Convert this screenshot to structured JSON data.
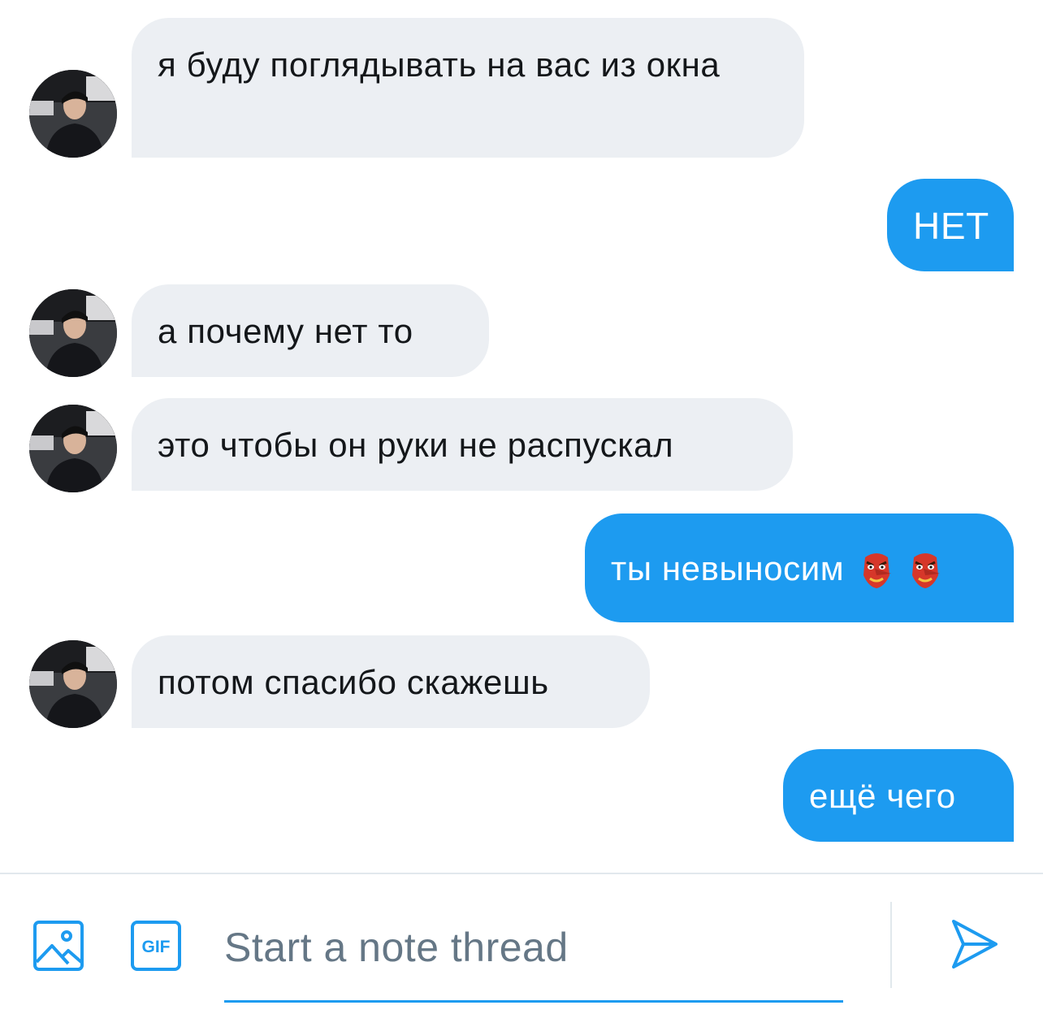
{
  "conversation": {
    "messages": [
      {
        "side": "in",
        "text": "я буду поглядывать на вас из окна"
      },
      {
        "side": "out",
        "text": "НЕТ"
      },
      {
        "side": "in",
        "text": "а почему нет то"
      },
      {
        "side": "in",
        "text": "это чтобы он руки не распускал"
      },
      {
        "side": "out",
        "text": "ты невыносим",
        "emoji": [
          "goblin-mask",
          "goblin-mask"
        ]
      },
      {
        "side": "in",
        "text": "потом спасибо скажешь"
      },
      {
        "side": "out",
        "text": "ещё чего"
      }
    ]
  },
  "composer": {
    "placeholder": "Start a note thread",
    "gif_label": "GIF",
    "icons": [
      "image-icon",
      "gif-icon",
      "send-icon"
    ]
  },
  "colors": {
    "outgoing_bubble": "#1d9bf0",
    "incoming_bubble": "#eceff3",
    "accent": "#1d9bf0"
  }
}
